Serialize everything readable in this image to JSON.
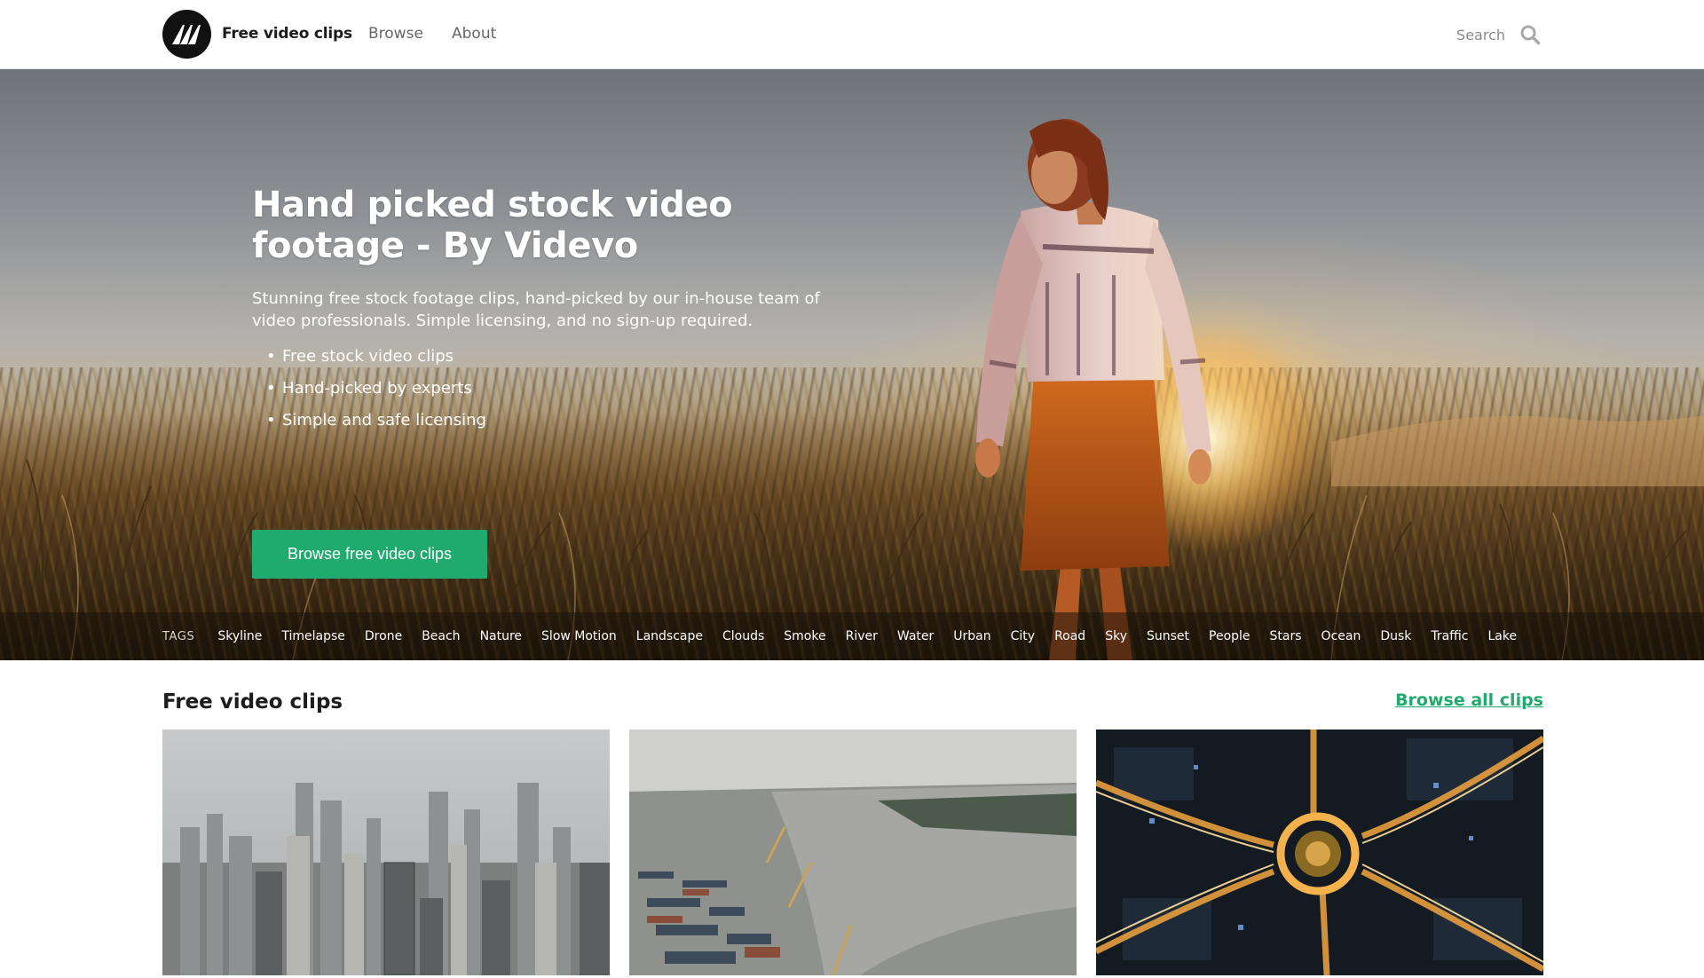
{
  "nav": {
    "brand_label": "Free video clips",
    "links": [
      "Browse",
      "About"
    ],
    "search_placeholder": "Search"
  },
  "hero": {
    "title": "Hand picked stock video footage - By Videvo",
    "subtitle": "Stunning free stock footage clips, hand-picked by our in-house team of video professionals. Simple licensing, and no sign-up required.",
    "bullets": [
      "Free stock video clips",
      "Hand-picked by experts",
      "Simple and safe licensing"
    ],
    "cta_label": "Browse free video clips"
  },
  "tags": {
    "label": "TAGS",
    "items": [
      "Skyline",
      "Timelapse",
      "Drone",
      "Beach",
      "Nature",
      "Slow Motion",
      "Landscape",
      "Clouds",
      "Smoke",
      "River",
      "Water",
      "Urban",
      "City",
      "Road",
      "Sky",
      "Sunset",
      "People",
      "Stars",
      "Ocean",
      "Dusk",
      "Traffic",
      "Lake"
    ]
  },
  "clips_section": {
    "title": "Free video clips",
    "browse_all_label": "Browse all clips",
    "thumbnails": [
      "city-skyline-aerial",
      "river-port-aerial",
      "night-roundabout-aerial"
    ]
  },
  "colors": {
    "accent": "#21aa6e",
    "nav_text": "#666666",
    "logo_bg": "#111111"
  }
}
